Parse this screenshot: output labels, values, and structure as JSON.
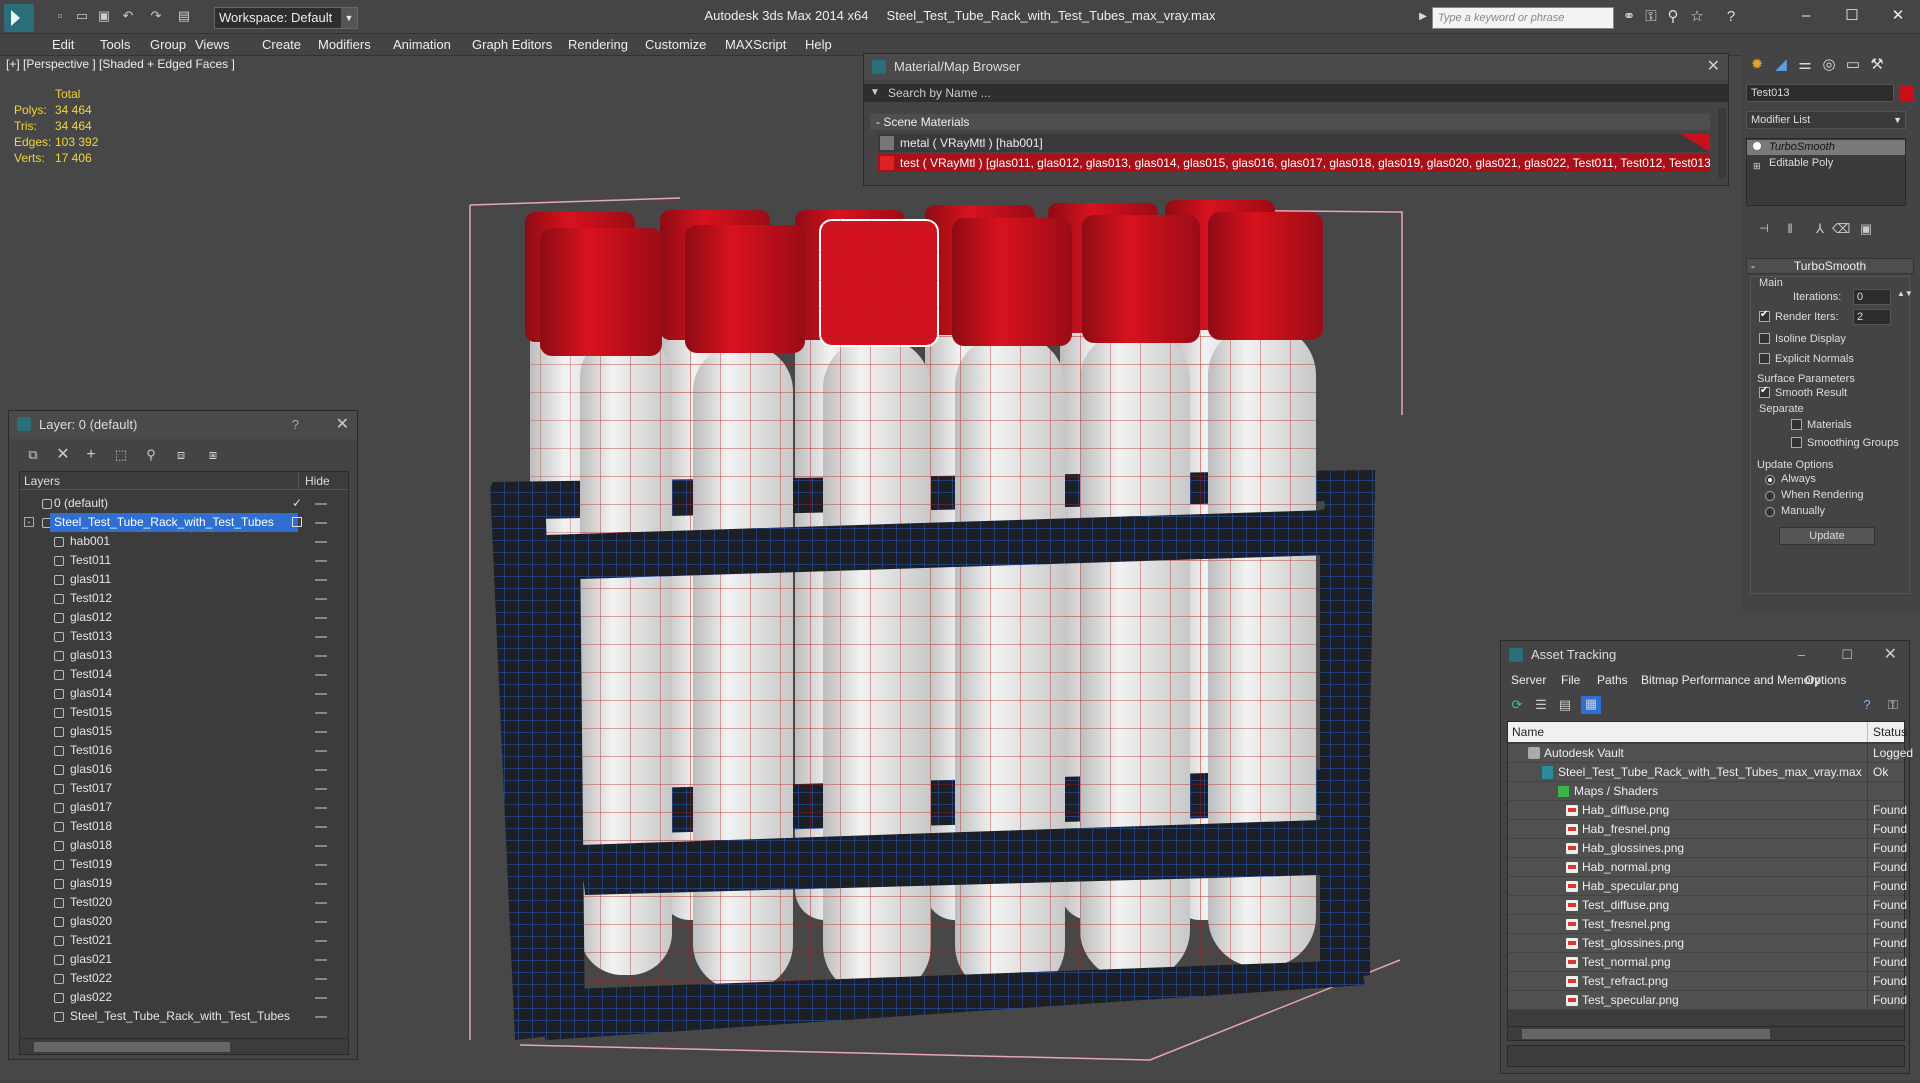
{
  "app": {
    "title": "Autodesk 3ds Max  2014 x64",
    "file": "Steel_Test_Tube_Rack_with_Test_Tubes_max_vray.max",
    "workspace": "Workspace: Default",
    "search_placeholder": "Type a keyword or phrase"
  },
  "menu": [
    "Edit",
    "Tools",
    "Group",
    "Views",
    "Create",
    "Modifiers",
    "Animation",
    "Graph Editors",
    "Rendering",
    "Customize",
    "MAXScript",
    "Help"
  ],
  "viewport": {
    "label": "[+] [Perspective ] [Shaded + Edged Faces ]",
    "stats_header": "Total",
    "stats": [
      {
        "label": "Polys:",
        "value": "34 464"
      },
      {
        "label": "Tris:",
        "value": "34 464"
      },
      {
        "label": "Edges:",
        "value": "103 392"
      },
      {
        "label": "Verts:",
        "value": "17 406"
      }
    ]
  },
  "material_browser": {
    "title": "Material/Map Browser",
    "search": "Search by Name ...",
    "section": "- Scene Materials",
    "materials": [
      "metal  ( VRayMtl ) [hab001]",
      "test  ( VRayMtl ) [glas011, glas012, glas013, glas014, glas015, glas016, glas017, glas018, glas019, glas020, glas021, glas022, Test011, Test012, Test013, Te..."
    ]
  },
  "layer_panel": {
    "title": "Layer: 0 (default)",
    "help": "?",
    "col_layers": "Layers",
    "col_hide": "Hide",
    "rows": [
      {
        "name": "0 (default)",
        "indent": 0
      },
      {
        "name": "Steel_Test_Tube_Rack_with_Test_Tubes",
        "indent": 0
      },
      {
        "name": "hab001",
        "indent": 1
      },
      {
        "name": "Test011",
        "indent": 1
      },
      {
        "name": "glas011",
        "indent": 1
      },
      {
        "name": "Test012",
        "indent": 1
      },
      {
        "name": "glas012",
        "indent": 1
      },
      {
        "name": "Test013",
        "indent": 1
      },
      {
        "name": "glas013",
        "indent": 1
      },
      {
        "name": "Test014",
        "indent": 1
      },
      {
        "name": "glas014",
        "indent": 1
      },
      {
        "name": "Test015",
        "indent": 1
      },
      {
        "name": "glas015",
        "indent": 1
      },
      {
        "name": "Test016",
        "indent": 1
      },
      {
        "name": "glas016",
        "indent": 1
      },
      {
        "name": "Test017",
        "indent": 1
      },
      {
        "name": "glas017",
        "indent": 1
      },
      {
        "name": "Test018",
        "indent": 1
      },
      {
        "name": "glas018",
        "indent": 1
      },
      {
        "name": "Test019",
        "indent": 1
      },
      {
        "name": "glas019",
        "indent": 1
      },
      {
        "name": "Test020",
        "indent": 1
      },
      {
        "name": "glas020",
        "indent": 1
      },
      {
        "name": "Test021",
        "indent": 1
      },
      {
        "name": "glas021",
        "indent": 1
      },
      {
        "name": "Test022",
        "indent": 1
      },
      {
        "name": "glas022",
        "indent": 1
      },
      {
        "name": "Steel_Test_Tube_Rack_with_Test_Tubes",
        "indent": 1
      }
    ]
  },
  "command_panel": {
    "object_name": "Test013",
    "modifier_list": "Modifier List",
    "stack": [
      "TurboSmooth",
      "Editable Poly"
    ],
    "rollout_title": "TurboSmooth",
    "main": "Main",
    "iterations_label": "Iterations:",
    "iterations": "0",
    "render_iters_label": "Render Iters:",
    "render_iters": "2",
    "isoline": "Isoline Display",
    "explicit": "Explicit Normals",
    "surface": "Surface Parameters",
    "smooth_result": "Smooth Result",
    "separate": "Separate",
    "materials": "Materials",
    "smoothing_groups": "Smoothing Groups",
    "update_options": "Update Options",
    "always": "Always",
    "when_rendering": "When Rendering",
    "manually": "Manually",
    "update": "Update"
  },
  "asset_tracking": {
    "title": "Asset Tracking",
    "menu": [
      "Server",
      "File",
      "Paths",
      "Bitmap Performance and Memory",
      "Options"
    ],
    "col_name": "Name",
    "col_status": "Status",
    "rows": [
      {
        "name": "Autodesk Vault",
        "status": "Logged",
        "indent": 1,
        "kind": "vault"
      },
      {
        "name": "Steel_Test_Tube_Rack_with_Test_Tubes_max_vray.max",
        "status": "Ok",
        "indent": 2,
        "kind": "max"
      },
      {
        "name": "Maps / Shaders",
        "status": "",
        "indent": 3,
        "kind": "folder"
      },
      {
        "name": "Hab_diffuse.png",
        "status": "Found",
        "indent": 4,
        "kind": "png"
      },
      {
        "name": "Hab_fresnel.png",
        "status": "Found",
        "indent": 4,
        "kind": "png"
      },
      {
        "name": "Hab_glossines.png",
        "status": "Found",
        "indent": 4,
        "kind": "png"
      },
      {
        "name": "Hab_normal.png",
        "status": "Found",
        "indent": 4,
        "kind": "png"
      },
      {
        "name": "Hab_specular.png",
        "status": "Found",
        "indent": 4,
        "kind": "png"
      },
      {
        "name": "Test_diffuse.png",
        "status": "Found",
        "indent": 4,
        "kind": "png"
      },
      {
        "name": "Test_fresnel.png",
        "status": "Found",
        "indent": 4,
        "kind": "png"
      },
      {
        "name": "Test_glossines.png",
        "status": "Found",
        "indent": 4,
        "kind": "png"
      },
      {
        "name": "Test_normal.png",
        "status": "Found",
        "indent": 4,
        "kind": "png"
      },
      {
        "name": "Test_refract.png",
        "status": "Found",
        "indent": 4,
        "kind": "png"
      },
      {
        "name": "Test_specular.png",
        "status": "Found",
        "indent": 4,
        "kind": "png"
      }
    ]
  },
  "colors": {
    "selection": "#2f6fd1",
    "cap": "#c8101c",
    "tube": "#e8e8e8",
    "rack_wire": "#2a5fc4",
    "stats": "#f2d53c"
  }
}
